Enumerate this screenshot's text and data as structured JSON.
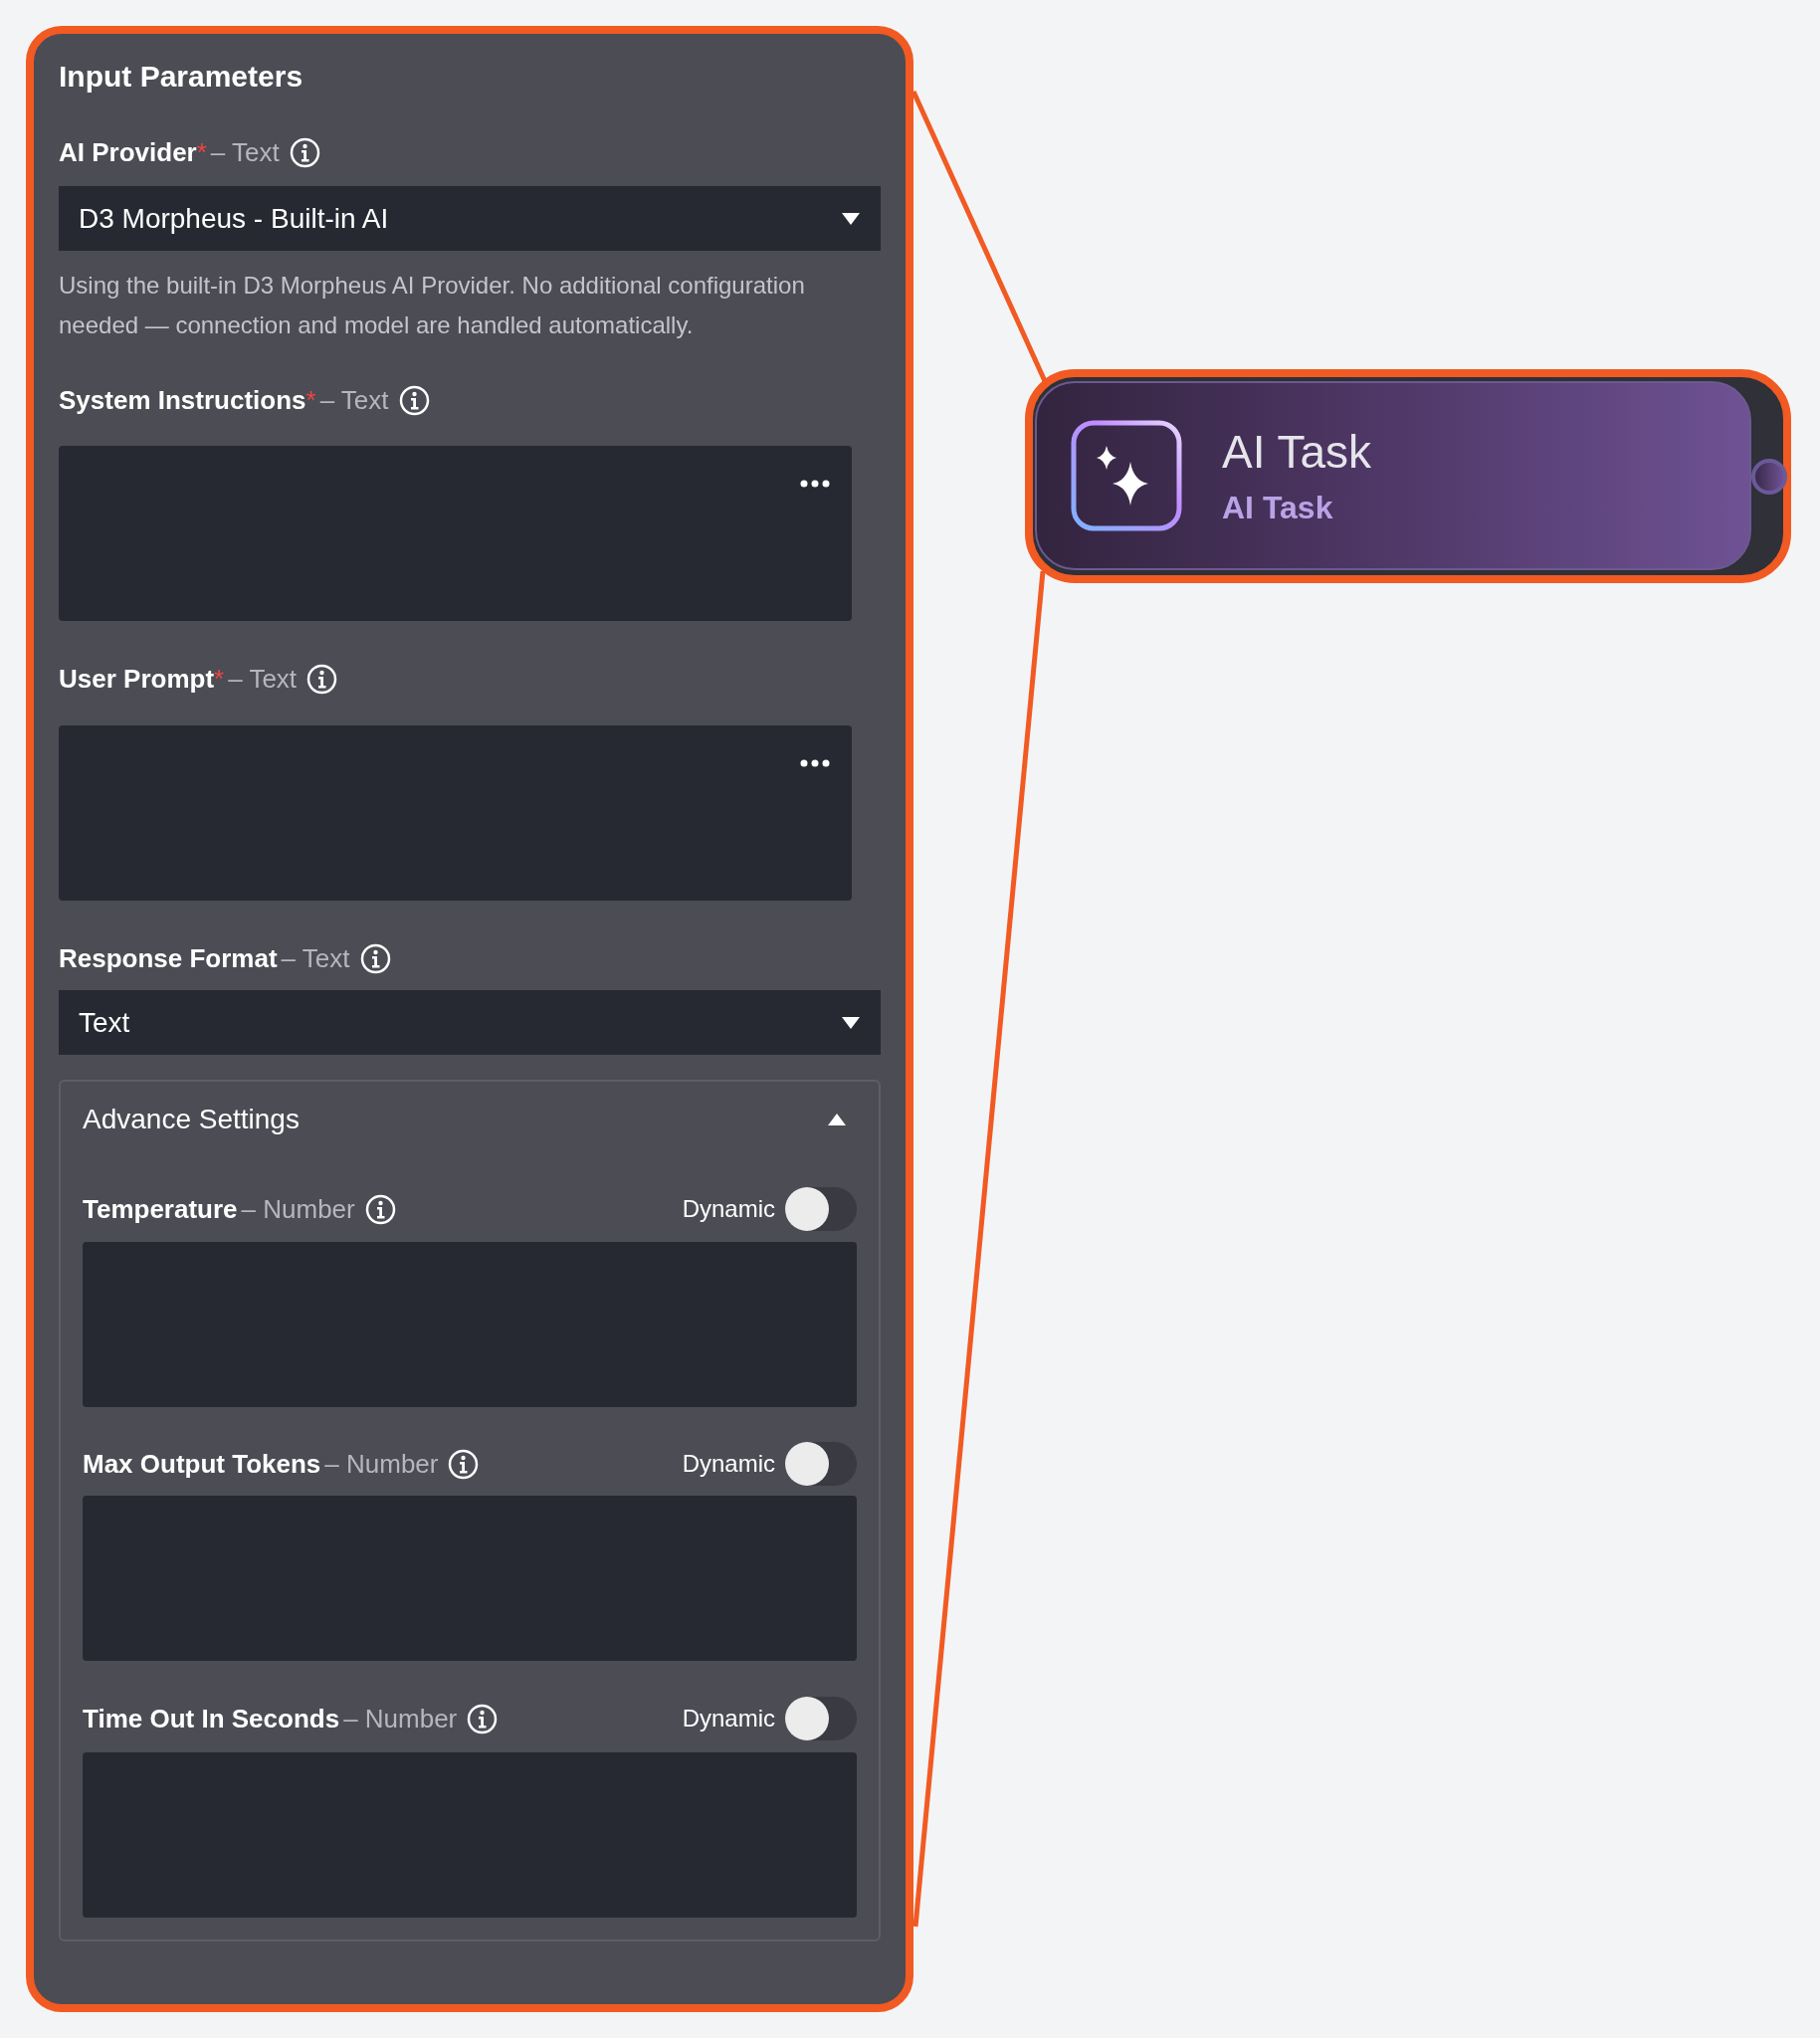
{
  "panel": {
    "title": "Input Parameters",
    "selected": true,
    "fields": [
      {
        "kind": "select",
        "label": "AI Provider",
        "required_mark": "*",
        "type": "– Text",
        "value": "D3 Morpheus - Built-in AI",
        "help": "Using the built-in D3 Morpheus AI Provider. No additional configuration needed — connection and model are handled automatically."
      },
      {
        "kind": "textarea",
        "label": "System Instructions",
        "required_mark": "*",
        "type": "– Text"
      },
      {
        "kind": "textarea",
        "label": "User Prompt",
        "required_mark": "*",
        "type": "– Text"
      },
      {
        "kind": "select",
        "label": "Response Format",
        "type": "– Text",
        "value": "Text"
      }
    ],
    "advanced": {
      "title": "Advance Settings",
      "expanded": true,
      "fields": [
        {
          "label": "Temperature",
          "type": "– Number",
          "dynamic_label": "Dynamic",
          "dynamic_on": false
        },
        {
          "label": "Max Output Tokens",
          "type": "– Number",
          "dynamic_label": "Dynamic",
          "dynamic_on": false
        },
        {
          "label": "Time Out In Seconds",
          "type": "– Number",
          "dynamic_label": "Dynamic",
          "dynamic_on": false
        }
      ]
    }
  },
  "node": {
    "title": "AI Task",
    "subtitle": "AI Task",
    "selected": true
  }
}
